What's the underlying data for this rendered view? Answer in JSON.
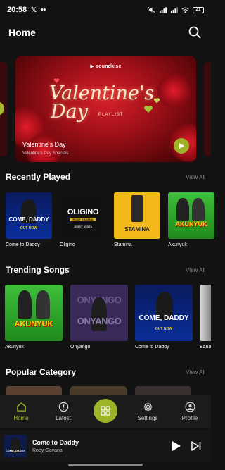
{
  "status_bar": {
    "time": "20:58",
    "battery": "21"
  },
  "header": {
    "title": "Home"
  },
  "banner": {
    "brand": "soundkise",
    "script_line1": "Valentine's",
    "script_line2": "Day",
    "playlist_label": "PLAYLIST",
    "title": "Valentine's Day",
    "subtitle": "Valentine's Day Specials"
  },
  "recently_played": {
    "title": "Recently Played",
    "view_all": "View All",
    "items": [
      {
        "label": "Come to Daddy",
        "cover_text": "COME, DADDY"
      },
      {
        "label": "Oligino",
        "cover_text": "OLIGINO"
      },
      {
        "label": "Stamina",
        "cover_text": "STAMINA"
      },
      {
        "label": "Akunyuk",
        "cover_text": "AKUNYUK"
      }
    ]
  },
  "trending_songs": {
    "title": "Trending Songs",
    "view_all": "View All",
    "items": [
      {
        "label": "Akunyuk",
        "cover_text": "AKUNYUK"
      },
      {
        "label": "Onyango",
        "cover_text": "ONYANGO"
      },
      {
        "label": "Come to Daddy",
        "cover_text": "COME, DADDY"
      },
      {
        "label": "Bana"
      }
    ]
  },
  "popular_category": {
    "title": "Popular Category",
    "view_all": "View All"
  },
  "bottom_nav": {
    "home": "Home",
    "latest": "Latest",
    "settings": "Settings",
    "profile": "Profile"
  },
  "mini_player": {
    "title": "Come to Daddy",
    "artist": "Rody Gavana"
  },
  "colors": {
    "accent": "#a4b82a",
    "background": "#121212",
    "nav_bg": "#1c1c1c"
  },
  "icons": [
    "x-logo-icon",
    "search-icon",
    "play-icon",
    "home-icon",
    "alert-circle-icon",
    "grid-icon",
    "gear-icon",
    "user-icon",
    "skip-next-icon"
  ]
}
